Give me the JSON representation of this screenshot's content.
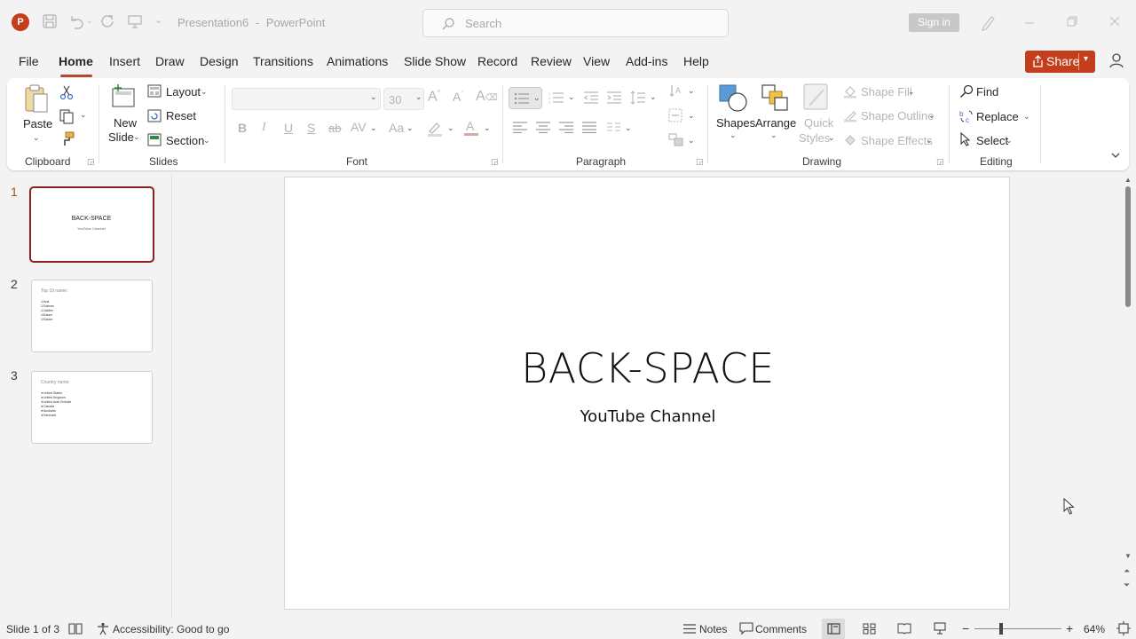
{
  "titlebar": {
    "app_icon_letter": "P",
    "doc_title": "Presentation6",
    "app_name": "PowerPoint",
    "search_placeholder": "Search",
    "signin_label": "Sign in"
  },
  "menu": {
    "tabs": [
      "File",
      "Home",
      "Insert",
      "Draw",
      "Design",
      "Transitions",
      "Animations",
      "Slide Show",
      "Record",
      "Review",
      "View",
      "Add-ins",
      "Help"
    ],
    "active_tab": "Home",
    "share_label": "Share"
  },
  "ribbon": {
    "clipboard": {
      "label": "Clipboard",
      "paste": "Paste"
    },
    "slides": {
      "label": "Slides",
      "new_slide_1": "New",
      "new_slide_2": "Slide",
      "layout": "Layout",
      "reset": "Reset",
      "section": "Section"
    },
    "font": {
      "label": "Font",
      "size_value": "30",
      "format_buttons": [
        "B",
        "I",
        "U",
        "S",
        "ab",
        "AV",
        "Aa"
      ]
    },
    "paragraph": {
      "label": "Paragraph"
    },
    "drawing": {
      "label": "Drawing",
      "shapes": "Shapes",
      "arrange": "Arrange",
      "quick_1": "Quick",
      "quick_2": "Styles",
      "shape_fill": "Shape Fill",
      "shape_outline": "Shape Outline",
      "shape_effects": "Shape Effects"
    },
    "editing": {
      "label": "Editing",
      "find": "Find",
      "replace": "Replace",
      "select": "Select"
    }
  },
  "slides_panel": [
    {
      "num": "1",
      "title": "BACK-SPACE",
      "subtitle": "YouTube Channel",
      "active": true
    },
    {
      "num": "2",
      "heading": "Top 10 name:",
      "bullets": [
        "Ada",
        "Salman",
        "Jabber",
        "Kalam",
        "Sarker"
      ]
    },
    {
      "num": "3",
      "heading": "Country name:",
      "bullets": [
        "United States",
        "United Kingdom",
        "United Arab Emirate",
        "Canada",
        "Australia",
        "Denmark"
      ]
    }
  ],
  "slide": {
    "title": "BACK-SPACE",
    "subtitle": "YouTube Channel"
  },
  "status": {
    "slide_pos": "Slide 1 of 3",
    "accessibility": "Accessibility: Good to go",
    "notes": "Notes",
    "comments": "Comments",
    "zoom_out": "−",
    "zoom_in": "+",
    "zoom": "64%"
  },
  "colors": {
    "accent": "#b7472a",
    "share_bg": "#c43e1c",
    "active_thumb_border": "#8b1e1e"
  }
}
